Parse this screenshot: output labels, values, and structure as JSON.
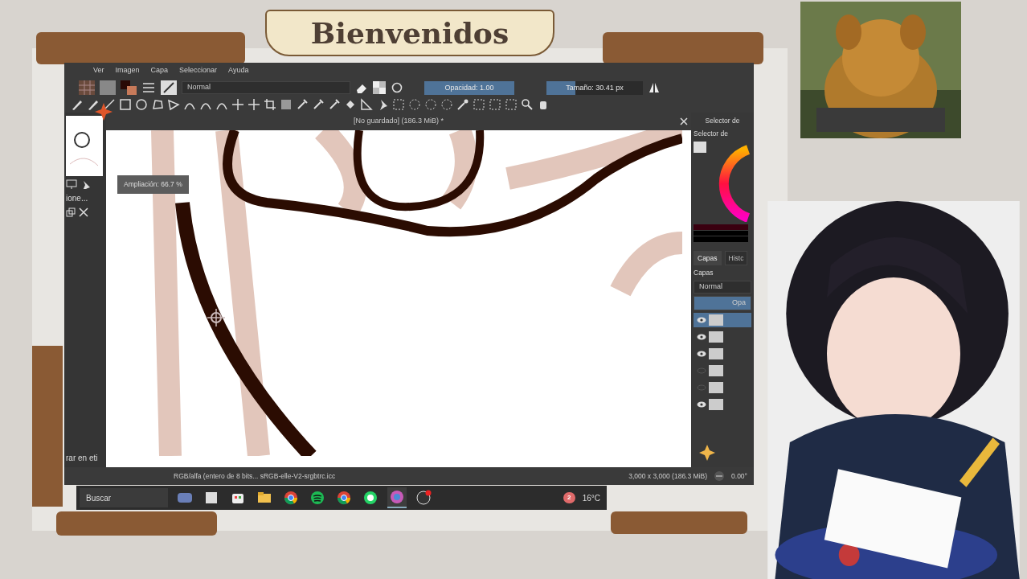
{
  "banner": {
    "title": "Bienvenidos"
  },
  "menu": [
    {
      "label": "Ver"
    },
    {
      "label": "Imagen"
    },
    {
      "label": "Capa"
    },
    {
      "label": "Seleccionar"
    },
    {
      "label": "Ayuda"
    }
  ],
  "toolbar": {
    "blend_mode": "Normal",
    "opacity": {
      "label": "Opacidad: 1.00",
      "level": 1
    },
    "size": {
      "label": "Tamaño: 30.41 px",
      "level": 0.3
    }
  },
  "document": {
    "title": "[No guardado]  (186.3 MiB) *"
  },
  "canvas": {
    "zoom_tooltip": "Ampliación: 66.7 %"
  },
  "left_dock": {
    "label_1": "ione...",
    "label_2": "rar en eti"
  },
  "right_dock": {
    "color_title": "Selector de",
    "color_subtitle": "Selector de",
    "tabs": [
      {
        "label": "Capas",
        "selected": true
      },
      {
        "label": "Histc",
        "selected": false
      }
    ],
    "layers_title": "Capas",
    "blend_mode": "Normal",
    "opacity_label": "Opa",
    "layers": [
      {
        "visible": true,
        "selected": true
      },
      {
        "visible": true,
        "selected": false
      },
      {
        "visible": true,
        "selected": false
      },
      {
        "visible": false,
        "selected": false
      },
      {
        "visible": false,
        "selected": false
      },
      {
        "visible": true,
        "selected": false
      }
    ]
  },
  "status_bar": {
    "color_space": "RGB/alfa (entero de 8 bits...  sRGB-elle-V2-srgbtrc.icc",
    "dimensions": "3,000 x 3,000 (186.3 MiB)",
    "rotation": "0.00°"
  },
  "taskbar": {
    "search_placeholder": "Buscar",
    "apps": [
      {
        "kind": "widget",
        "active": false
      },
      {
        "kind": "window",
        "active": false
      },
      {
        "kind": "store",
        "active": false
      },
      {
        "kind": "folder",
        "active": false
      },
      {
        "kind": "chrome",
        "active": false
      },
      {
        "kind": "spotify",
        "active": false
      },
      {
        "kind": "chrome",
        "active": false
      },
      {
        "kind": "whatsapp",
        "active": false
      },
      {
        "kind": "krita",
        "active": true
      },
      {
        "kind": "obs",
        "active": false
      }
    ],
    "notification_count": "2",
    "temperature": "16°C"
  }
}
